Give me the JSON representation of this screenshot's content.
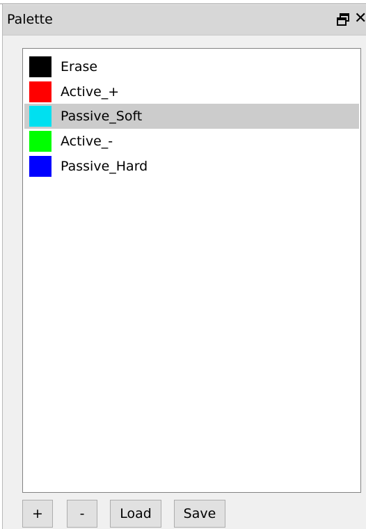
{
  "window": {
    "title": "Palette",
    "float_icon": "float-restore-icon",
    "close_glyph": "✕",
    "close_icon": "close-icon"
  },
  "palette": {
    "items": [
      {
        "label": "Erase",
        "color": "#000000",
        "selected": false
      },
      {
        "label": "Active_+",
        "color": "#ff0000",
        "selected": false
      },
      {
        "label": "Passive_Soft",
        "color": "#00e0f0",
        "selected": true
      },
      {
        "label": "Active_-",
        "color": "#00ff00",
        "selected": false
      },
      {
        "label": "Passive_Hard",
        "color": "#0000ff",
        "selected": false
      }
    ],
    "selection_color": "#cccccc"
  },
  "buttons": {
    "add_label": "+",
    "remove_label": "-",
    "load_label": "Load",
    "save_label": "Save"
  }
}
